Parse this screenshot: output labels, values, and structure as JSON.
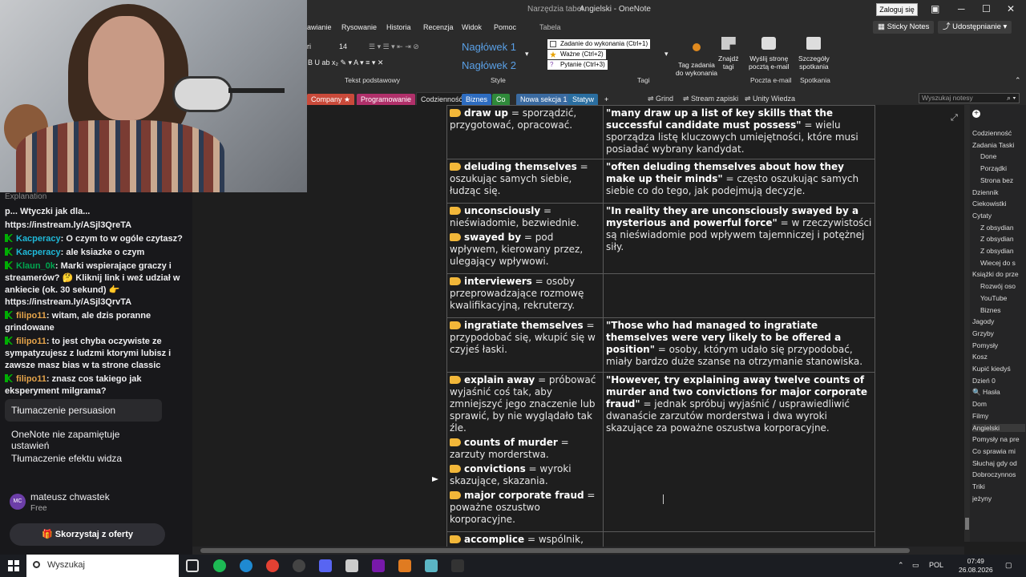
{
  "window": {
    "title": "Angielski  -  OneNote",
    "context_tab": "Narzędzia tabel",
    "login_button": "Zaloguj się",
    "menu_tabs": [
      "awianie",
      "Rysowanie",
      "Historia",
      "Recenzja",
      "Widok",
      "Pomoc",
      "Tabela"
    ],
    "sticky_notes": "Sticky Notes",
    "share": "Udostępnianie"
  },
  "ribbon": {
    "font_size": "14",
    "font_name": "ri",
    "styles": [
      "Nagłówek 1",
      "Nagłówek 2"
    ],
    "tags": [
      "Zadanie do wykonania (Ctrl+1)",
      "Ważne (Ctrl+2)",
      "Pytanie (Ctrl+3)"
    ],
    "buttons": {
      "tag_todo": [
        "Tag zadania",
        "do wykonania"
      ],
      "find_tags": [
        "Znajdź",
        "tagi"
      ],
      "send_email": [
        "Wyślij stronę",
        "pocztą e-mail"
      ],
      "meeting_details": [
        "Szczegóły",
        "spotkania"
      ]
    },
    "groups": {
      "basic_text": "Tekst podstawowy",
      "style": "Style",
      "tags": "Tagi",
      "email": "Poczta e-mail",
      "meetings": "Spotkania"
    }
  },
  "sections": {
    "tabs": [
      {
        "label": "Company ★",
        "color": "#c94a3a"
      },
      {
        "label": "Programowanie",
        "color": "#b0306a"
      },
      {
        "label": "Codzienność",
        "color": "#1e1e1e"
      },
      {
        "label": "Biznes",
        "color": "#2d6cc0"
      },
      {
        "label": "Co",
        "color": "#2f8a3a"
      },
      {
        "label": "Nowa sekcja 1",
        "color": "#3a6aa0"
      },
      {
        "label": "Statyw",
        "color": "#2a6ea0"
      }
    ],
    "add": "+",
    "quick_links": [
      "Grind",
      "Stream zapiski",
      "Unity Wiedza"
    ],
    "search_placeholder": "Wyszukaj notesy"
  },
  "note_rows": [
    {
      "terms": [
        {
          "term": "draw up",
          "def": " = sporządzić, przygotować, opracować."
        }
      ],
      "quote": "\"many draw up a list of key skills that the successful candidate must possess\"",
      "translation": " = wielu sporządza listę kluczowych umiejętności, które musi posiadać wybrany kandydat."
    },
    {
      "terms": [
        {
          "term": "deluding themselves",
          "def": " = oszukując samych siebie, łudząc się."
        }
      ],
      "quote": "\"often deluding themselves about how they make up their minds\"",
      "translation": " = często oszukując samych siebie co do tego, jak podejmują decyzje."
    },
    {
      "terms": [
        {
          "term": "unconsciously",
          "def": " = nieświadomie, bezwiednie."
        },
        {
          "term": "swayed by",
          "def": " = pod wpływem, kierowany przez, ulegający wpływowi."
        }
      ],
      "quote": "\"In reality they are unconsciously swayed by a mysterious and powerful force\"",
      "translation": " = w rzeczywistości są nieświadomie pod wpływem tajemniczej i potężnej siły."
    },
    {
      "terms": [
        {
          "term": "interviewers",
          "def": " = osoby przeprowadzające rozmowę kwalifikacyjną, rekruterzy."
        }
      ],
      "quote": "",
      "translation": ""
    },
    {
      "terms": [
        {
          "term": "ingratiate themselves",
          "def": " = przypodobać się, wkupić się w czyjeś łaski."
        }
      ],
      "quote": "\"Those who had managed to ingratiate themselves were very likely to be offered a position\"",
      "translation": " = osoby, którym udało się przypodobać, miały bardzo duże szanse na otrzymanie stanowiska."
    },
    {
      "terms": [
        {
          "term": "explain away",
          "def": " = próbować wyjaśnić coś tak, aby zmniejszyć jego znaczenie lub sprawić, by nie wyglądało tak źle."
        },
        {
          "term": "counts of murder",
          "def": " = zarzuty morderstwa."
        },
        {
          "term": "convictions",
          "def": " = wyroki skazujące, skazania."
        },
        {
          "term": "major corporate fraud",
          "def": " = poważne oszustwo korporacyjne."
        }
      ],
      "quote": "\"However, try explaining away twelve counts of murder and two convictions for major corporate fraud\"",
      "translation": " = jednak spróbuj wyjaśnić / usprawiedliwić dwanaście zarzutów morderstwa i dwa wyroki skazujące za poważne oszustwa korporacyjne."
    },
    {
      "terms": [
        {
          "term": "accomplice",
          "def": " = wspólnik, pomocnik, osoba współuczestnicząca w czymś (zwykle w czymś złym lub nielegalnym)."
        }
      ],
      "quote": "",
      "translation": ""
    }
  ],
  "page_list": [
    {
      "label": "Codzienność",
      "sub": false,
      "selected": false
    },
    {
      "label": "Zadania Taski",
      "sub": false,
      "selected": false
    },
    {
      "label": "Done",
      "sub": true,
      "selected": false
    },
    {
      "label": "Porządki",
      "sub": true,
      "selected": false
    },
    {
      "label": "Strona bez",
      "sub": true,
      "selected": false
    },
    {
      "label": "Dziennik",
      "sub": false,
      "selected": false
    },
    {
      "label": "Ciekowistki",
      "sub": false,
      "selected": false
    },
    {
      "label": "Cytaty",
      "sub": false,
      "selected": false
    },
    {
      "label": "Z obsydian",
      "sub": true,
      "selected": false
    },
    {
      "label": "Z obsydian",
      "sub": true,
      "selected": false
    },
    {
      "label": "Z obsydian",
      "sub": true,
      "selected": false
    },
    {
      "label": "Wiecej do s",
      "sub": true,
      "selected": false
    },
    {
      "label": "Książki do prze",
      "sub": false,
      "selected": false
    },
    {
      "label": "Rozwój oso",
      "sub": true,
      "selected": false
    },
    {
      "label": "YouTube",
      "sub": true,
      "selected": false
    },
    {
      "label": "Biznes",
      "sub": true,
      "selected": false
    },
    {
      "label": "Jagody",
      "sub": false,
      "selected": false
    },
    {
      "label": "Grzyby",
      "sub": false,
      "selected": false
    },
    {
      "label": "Pomysły",
      "sub": false,
      "selected": false
    },
    {
      "label": "Kosz",
      "sub": false,
      "selected": false
    },
    {
      "label": "Kupić kiedyś",
      "sub": false,
      "selected": false
    },
    {
      "label": "Dzień 0",
      "sub": false,
      "selected": false
    },
    {
      "label": "🔍 Hasła",
      "sub": false,
      "selected": false
    },
    {
      "label": "Dom",
      "sub": false,
      "selected": false
    },
    {
      "label": "Filmy",
      "sub": false,
      "selected": false
    },
    {
      "label": "Angielski",
      "sub": false,
      "selected": true
    },
    {
      "label": "Pomysły na pre",
      "sub": false,
      "selected": false
    },
    {
      "label": "Co sprawia mi",
      "sub": false,
      "selected": false
    },
    {
      "label": "Słuchaj gdy od",
      "sub": false,
      "selected": false
    },
    {
      "label": "Dobroczynnos",
      "sub": false,
      "selected": false
    },
    {
      "label": "Triki",
      "sub": false,
      "selected": false
    },
    {
      "label": "jeżyny",
      "sub": false,
      "selected": false
    }
  ],
  "chat": {
    "cut_line": "Explanation",
    "messages": [
      {
        "user": "",
        "text": "p... Wtyczki jak dla...",
        "badge": false,
        "cls": ""
      },
      {
        "user": "",
        "text": "https://instream.ly/ASjl3QreTA",
        "badge": false,
        "cls": ""
      },
      {
        "user": "Kacperacy",
        "text": " O czym to w ogóle czytasz?",
        "badge": true,
        "cls": ""
      },
      {
        "user": "Kacperacy",
        "text": " ale ksiazke o czym",
        "badge": true,
        "cls": ""
      },
      {
        "user": "Klaun_0k",
        "text": " Marki wspierające graczy i streamerów? 🤔 Kliknij link i weź udział w ankiecie (ok. 30 sekund) 👉 https://instream.ly/ASjl3QrvTA",
        "badge": true,
        "cls": "u2"
      },
      {
        "user": "filipo11",
        "text": " witam, ale dzis poranne grindowane",
        "badge": true,
        "cls": "u3"
      },
      {
        "user": "filipo11",
        "text": " to jest chyba oczywiste ze sympatyzujesz z ludzmi ktorymi lubisz i zawsze masz bias w ta strone classic",
        "badge": true,
        "cls": "u3"
      },
      {
        "user": "filipo11",
        "text": " znasz cos takiego jak eksperyment milgrama?",
        "badge": true,
        "cls": "u3"
      }
    ],
    "conversations": [
      "Tłumaczenie persuasion",
      "OneNote nie zapamiętuje ustawień",
      "Tłumaczenie efektu widza"
    ],
    "account": {
      "initials": "MC",
      "name": "mateusz chwastek",
      "plan": "Free"
    },
    "offer_button": "Skorzystaj z oferty"
  },
  "taskbar": {
    "search_placeholder": "Wyszukaj",
    "lang": "POL",
    "time": "07:49",
    "date": "26.08.2026",
    "apps": [
      {
        "name": "spotify-icon",
        "color": "#1db954"
      },
      {
        "name": "edge-icon",
        "color": "#1f8ad2"
      },
      {
        "name": "chrome-icon",
        "color": "#e34133"
      },
      {
        "name": "obs-icon",
        "color": "#444"
      },
      {
        "name": "discord-icon",
        "color": "#5865f2"
      },
      {
        "name": "clock-app-icon",
        "color": "#ccc"
      },
      {
        "name": "onenote-icon",
        "color": "#7719aa"
      },
      {
        "name": "app-orange-icon",
        "color": "#e07b21"
      },
      {
        "name": "app-teal-icon",
        "color": "#5bb5c4"
      },
      {
        "name": "app-dark-icon",
        "color": "#333"
      }
    ]
  }
}
